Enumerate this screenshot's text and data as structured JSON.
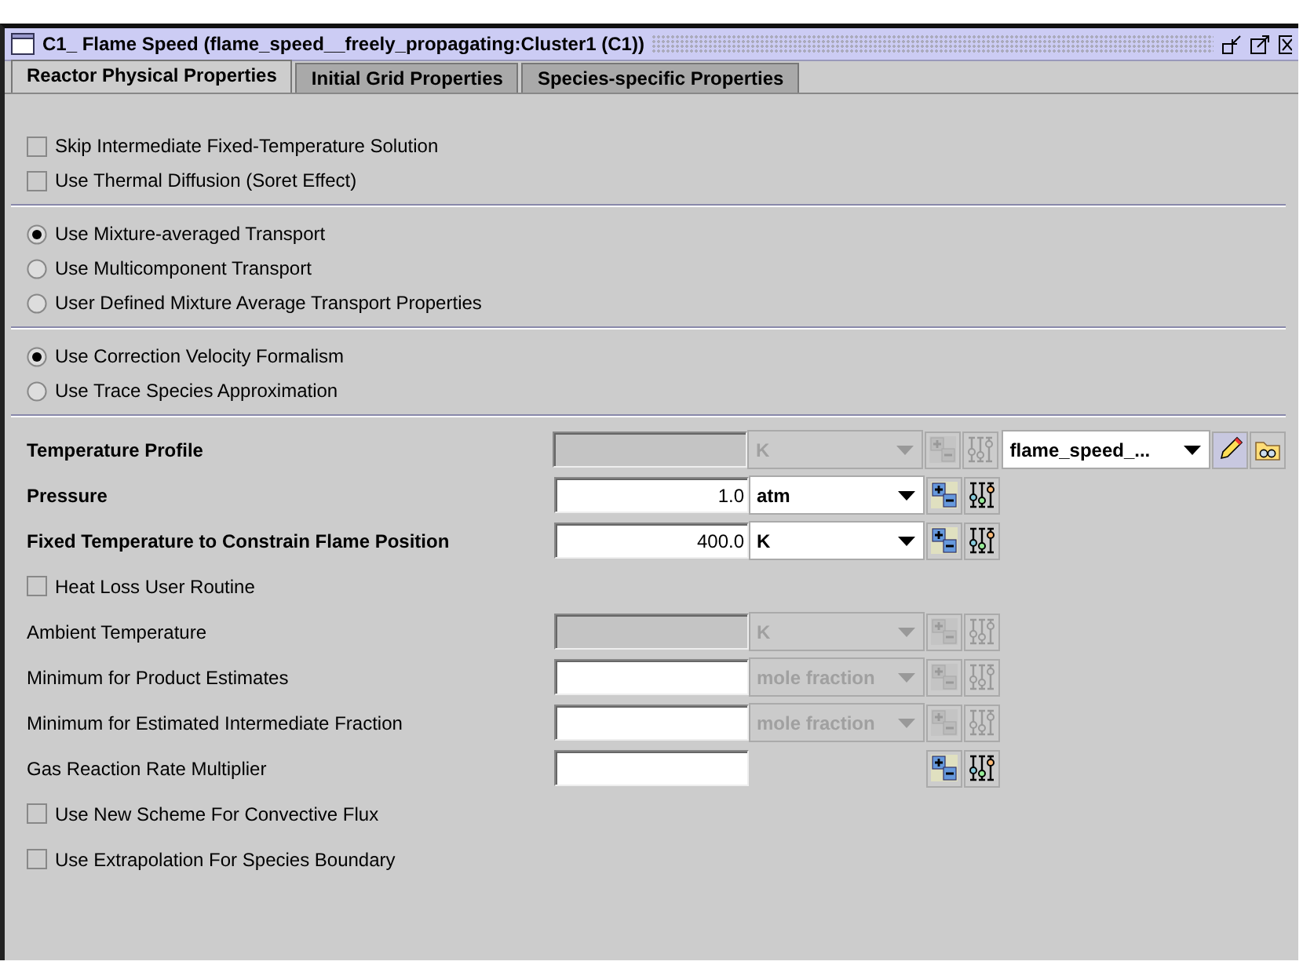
{
  "window": {
    "title": "C1_ Flame Speed  (flame_speed__freely_propagating:Cluster1 (C1))"
  },
  "tabs": [
    {
      "label": "Reactor Physical Properties",
      "selected": true
    },
    {
      "label": "Initial Grid Properties",
      "selected": false
    },
    {
      "label": "Species-specific Properties",
      "selected": false
    }
  ],
  "option_groups": [
    {
      "kind": "checkbox",
      "items": [
        {
          "label": "Skip Intermediate Fixed-Temperature Solution",
          "checked": false
        },
        {
          "label": "Use Thermal Diffusion (Soret Effect)",
          "checked": false
        }
      ]
    },
    {
      "kind": "radio",
      "items": [
        {
          "label": "Use Mixture-averaged Transport",
          "selected": true
        },
        {
          "label": "Use Multicomponent Transport",
          "selected": false
        },
        {
          "label": "User Defined Mixture Average Transport Properties",
          "selected": false
        }
      ]
    },
    {
      "kind": "radio",
      "items": [
        {
          "label": "Use Correction Velocity Formalism",
          "selected": true
        },
        {
          "label": "Use Trace Species Approximation",
          "selected": false
        }
      ]
    }
  ],
  "property_rows": [
    {
      "kind": "field",
      "label": "Temperature Profile",
      "bold": true,
      "input": {
        "disabled": true
      },
      "unit": {
        "value": "K",
        "disabled": true
      },
      "tools_disabled": true,
      "profile": {
        "value": "flame_speed_..."
      }
    },
    {
      "kind": "field",
      "label": "Pressure",
      "bold": true,
      "input": {
        "value": "1.0",
        "disabled": false
      },
      "unit": {
        "value": "atm",
        "disabled": false
      },
      "tools_disabled": false
    },
    {
      "kind": "field",
      "label": "Fixed Temperature to Constrain Flame Position",
      "bold": true,
      "input": {
        "value": "400.0",
        "disabled": false
      },
      "unit": {
        "value": "K",
        "disabled": false
      },
      "tools_disabled": false
    },
    {
      "kind": "checkbox",
      "label": "Heat Loss User Routine",
      "checked": false
    },
    {
      "kind": "field",
      "label": "Ambient Temperature",
      "bold": false,
      "input": {
        "disabled": true
      },
      "unit": {
        "value": "K",
        "disabled": true
      },
      "tools_disabled": true
    },
    {
      "kind": "field",
      "label": "Minimum for Product Estimates",
      "bold": false,
      "input": {
        "disabled": false
      },
      "unit": {
        "value": "mole fraction",
        "disabled": true
      },
      "tools_disabled": true
    },
    {
      "kind": "field",
      "label": "Minimum for Estimated Intermediate Fraction",
      "bold": false,
      "input": {
        "disabled": false
      },
      "unit": {
        "value": "mole fraction",
        "disabled": true
      },
      "tools_disabled": true
    },
    {
      "kind": "field",
      "label": "Gas Reaction Rate Multiplier",
      "bold": false,
      "input": {
        "disabled": false
      },
      "tools_disabled": false
    },
    {
      "kind": "checkbox",
      "label": "Use New Scheme For Convective Flux",
      "checked": false
    },
    {
      "kind": "checkbox",
      "label": "Use Extrapolation For Species Boundary",
      "checked": false
    }
  ]
}
